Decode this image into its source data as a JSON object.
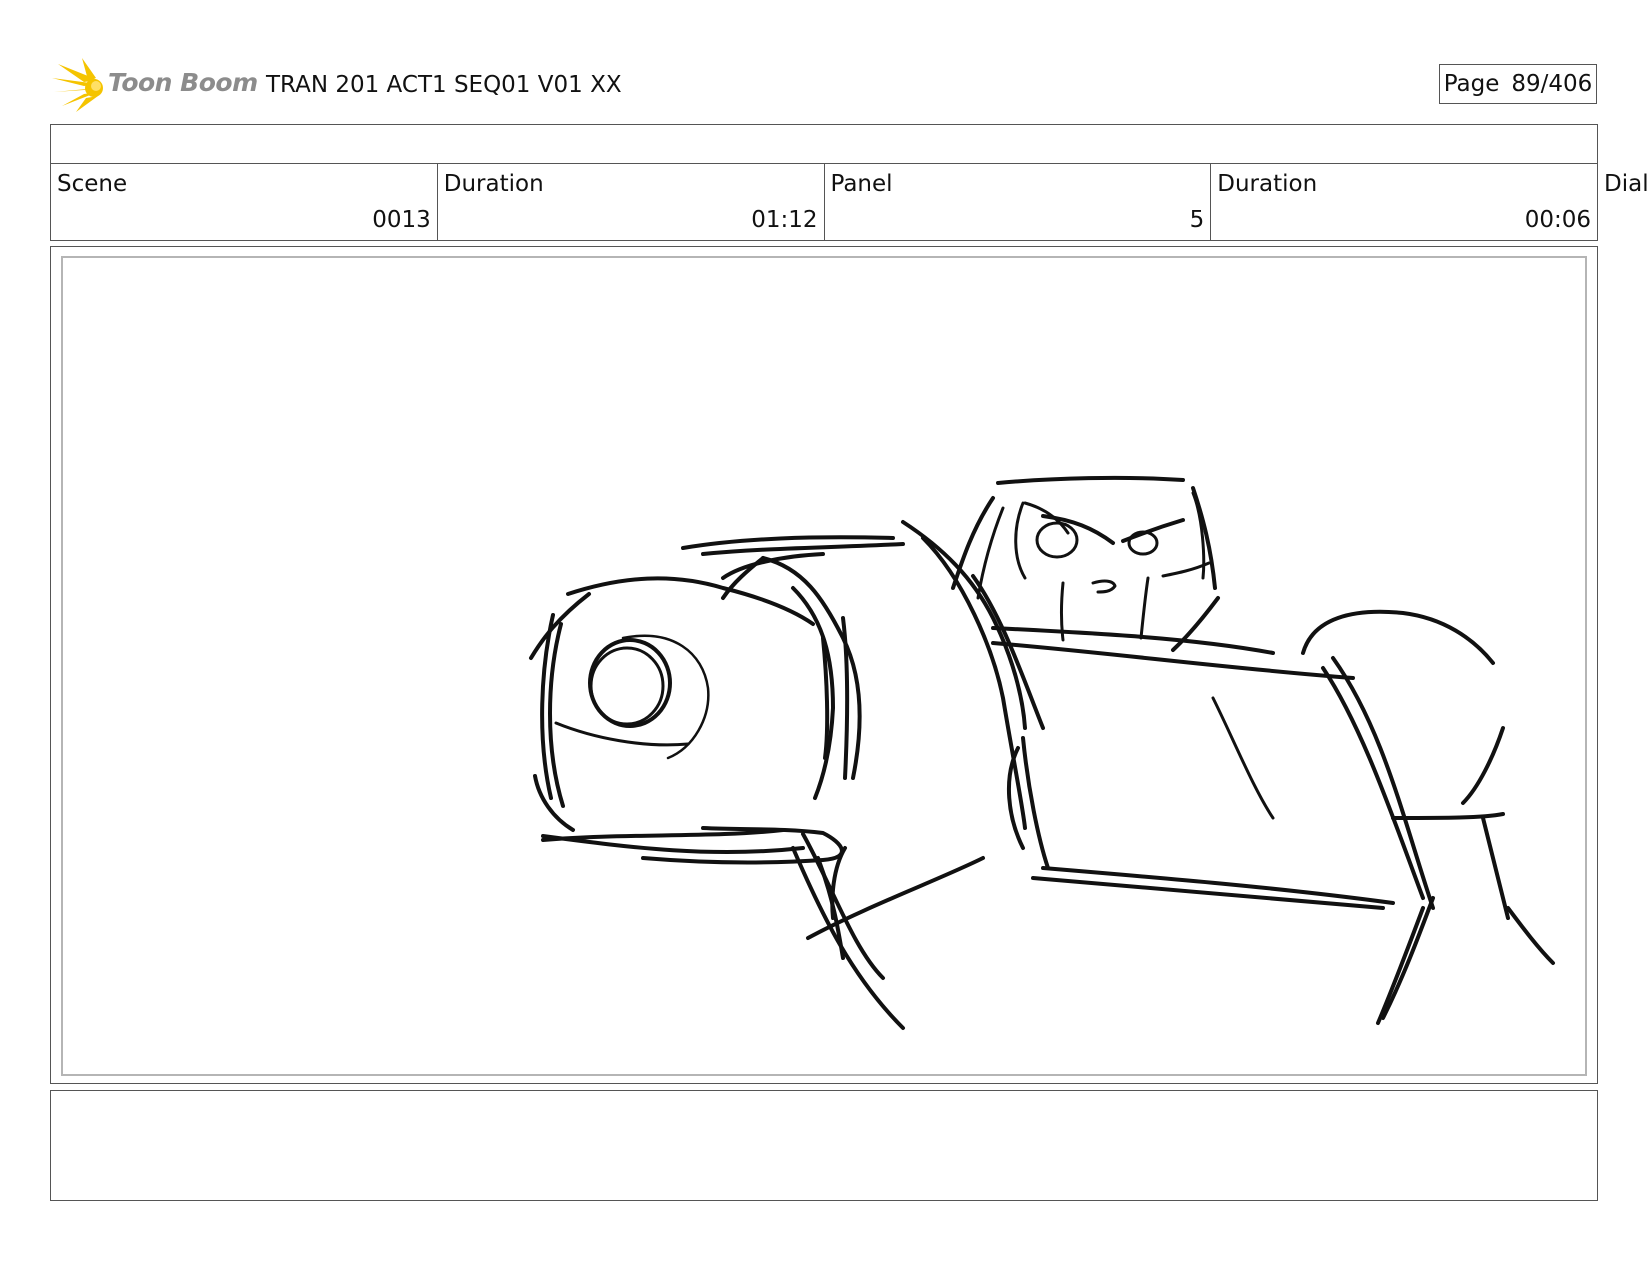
{
  "header": {
    "logo_text": "Toon Boom",
    "document_title": "TRAN 201 ACT1 SEQ01 V01 XX",
    "page_label": "Page",
    "page_number": "89/406"
  },
  "info_row": {
    "scene_label": "Scene",
    "scene_value": "0013",
    "scene_duration_label": "Duration",
    "scene_duration_value": "01:12",
    "panel_label": "Panel",
    "panel_value": "5",
    "panel_duration_label": "Duration",
    "panel_duration_value": "00:06",
    "overflow_label": "Dial"
  },
  "colors": {
    "logo_star": "#f5c400",
    "logo_text": "#8c8c8c",
    "border": "#555555",
    "panel_inner_border": "#b5b5b5",
    "sketch_stroke": "#111111"
  },
  "icons": {
    "logo_mark": "starburst-icon"
  }
}
